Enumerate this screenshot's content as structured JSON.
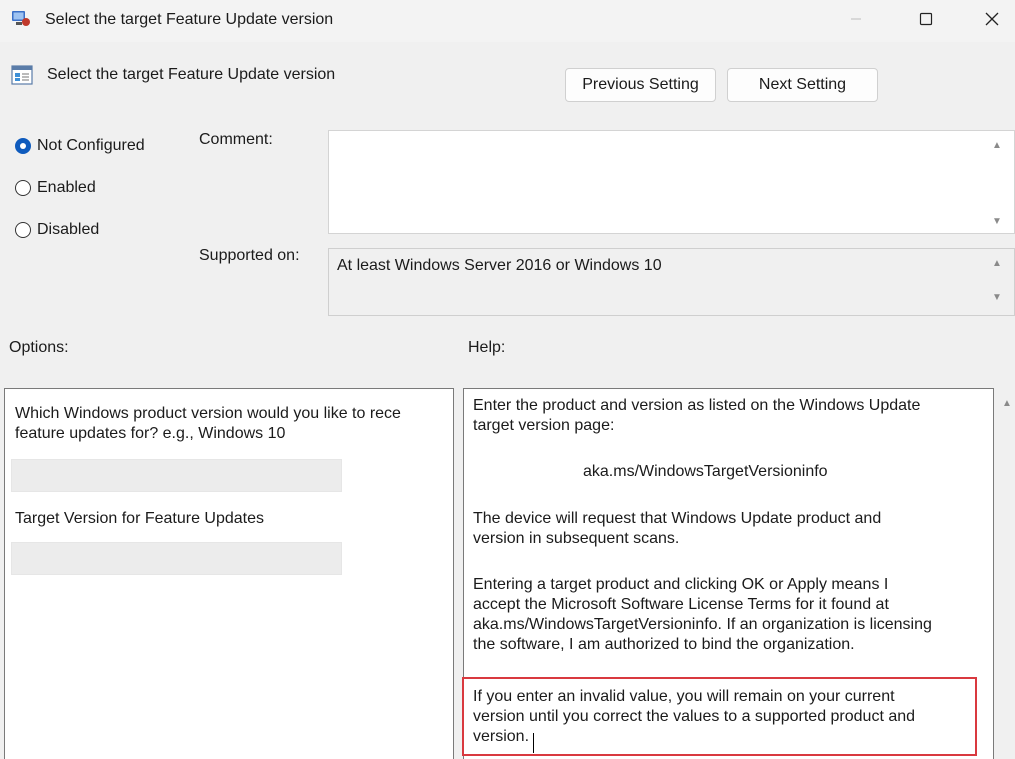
{
  "window": {
    "title": "Select the target Feature Update version",
    "icons": {
      "app": "group-policy-icon",
      "minimize": "minimize-icon",
      "maximize": "maximize-icon",
      "close": "close-icon"
    }
  },
  "header": {
    "setting_title": "Select the target Feature Update version",
    "setting_icon": "policy-setting-icon",
    "previous_label": "Previous Setting",
    "next_label": "Next Setting"
  },
  "state": {
    "options": [
      {
        "label": "Not Configured",
        "checked": true
      },
      {
        "label": "Enabled",
        "checked": false
      },
      {
        "label": "Disabled",
        "checked": false
      }
    ]
  },
  "comment": {
    "label": "Comment:",
    "value": ""
  },
  "supported": {
    "label": "Supported on:",
    "value": "At least Windows Server 2016 or Windows 10"
  },
  "sections": {
    "options_label": "Options:",
    "help_label": "Help:"
  },
  "options_panel": {
    "question_line1": "Which Windows product version would you like to rece",
    "question_line2": "feature updates for? e.g., Windows 10",
    "product_value": "",
    "target_label": "Target Version for Feature Updates",
    "target_value": ""
  },
  "help_panel": {
    "p1_line1": "Enter the product and version as listed on the Windows Update",
    "p1_line2": "target version page:",
    "link": "aka.ms/WindowsTargetVersioninfo",
    "p2_line1": "The device will request that Windows Update product and",
    "p2_line2": "version in subsequent scans.",
    "p3_line1": "Entering a target product and clicking OK or Apply means I",
    "p3_line2": "accept the Microsoft Software License Terms for it found at",
    "p3_line3": "aka.ms/WindowsTargetVersioninfo. If an organization is licensing",
    "p3_line4": "the software, I am authorized to bind the organization.",
    "p4_line1": "If you enter an invalid value, you will remain on your current",
    "p4_line2": "version until you correct the values to a supported product and",
    "p4_line3": "version."
  },
  "colors": {
    "accent": "#0f5bbd",
    "highlight_border": "#d9393f"
  }
}
